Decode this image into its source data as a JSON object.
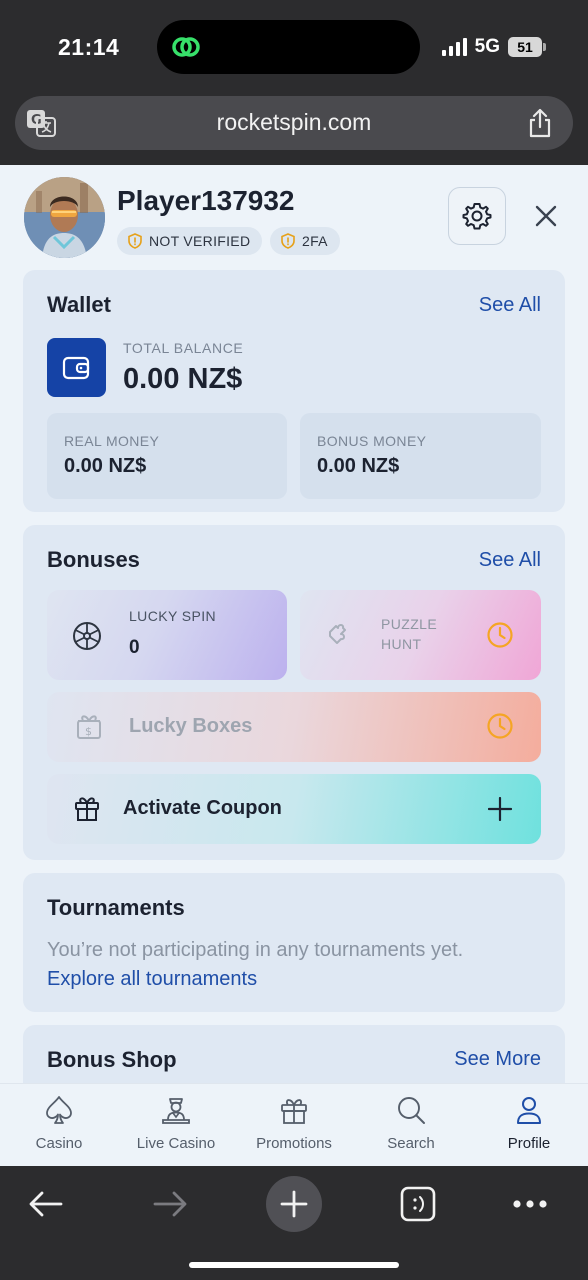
{
  "status_bar": {
    "time": "21:14",
    "network": "5G",
    "battery": "51"
  },
  "browser": {
    "url": "rocketspin.com"
  },
  "profile": {
    "username": "Player137932",
    "badges": [
      "NOT VERIFIED",
      "2FA"
    ]
  },
  "wallet": {
    "title": "Wallet",
    "see_all": "See All",
    "total_label": "TOTAL BALANCE",
    "total_value": "0.00 NZ$",
    "real_label": "REAL MONEY",
    "real_value": "0.00 NZ$",
    "bonus_label": "BONUS MONEY",
    "bonus_value": "0.00 NZ$"
  },
  "bonuses": {
    "title": "Bonuses",
    "see_all": "See All",
    "lucky_spin_label": "LUCKY SPIN",
    "lucky_spin_value": "0",
    "puzzle_label_1": "PUZZLE",
    "puzzle_label_2": "HUNT",
    "lucky_boxes_label": "Lucky Boxes",
    "coupon_label": "Activate Coupon"
  },
  "tournaments": {
    "title": "Tournaments",
    "message": "You’re not participating in any tournaments yet.",
    "link": "Explore all tournaments"
  },
  "bonus_shop": {
    "title": "Bonus Shop",
    "see_more": "See More"
  },
  "nav": [
    {
      "label": "Casino",
      "icon": "spade-icon"
    },
    {
      "label": "Live Casino",
      "icon": "dealer-icon"
    },
    {
      "label": "Promotions",
      "icon": "gift-icon"
    },
    {
      "label": "Search",
      "icon": "search-icon"
    },
    {
      "label": "Profile",
      "icon": "user-icon",
      "active": true
    }
  ],
  "colors": {
    "accent_blue": "#1f4ea8",
    "wallet_icon_bg": "#1543a6",
    "warning_orange": "#f5a524",
    "chrome_dark": "#2c2c2e"
  }
}
